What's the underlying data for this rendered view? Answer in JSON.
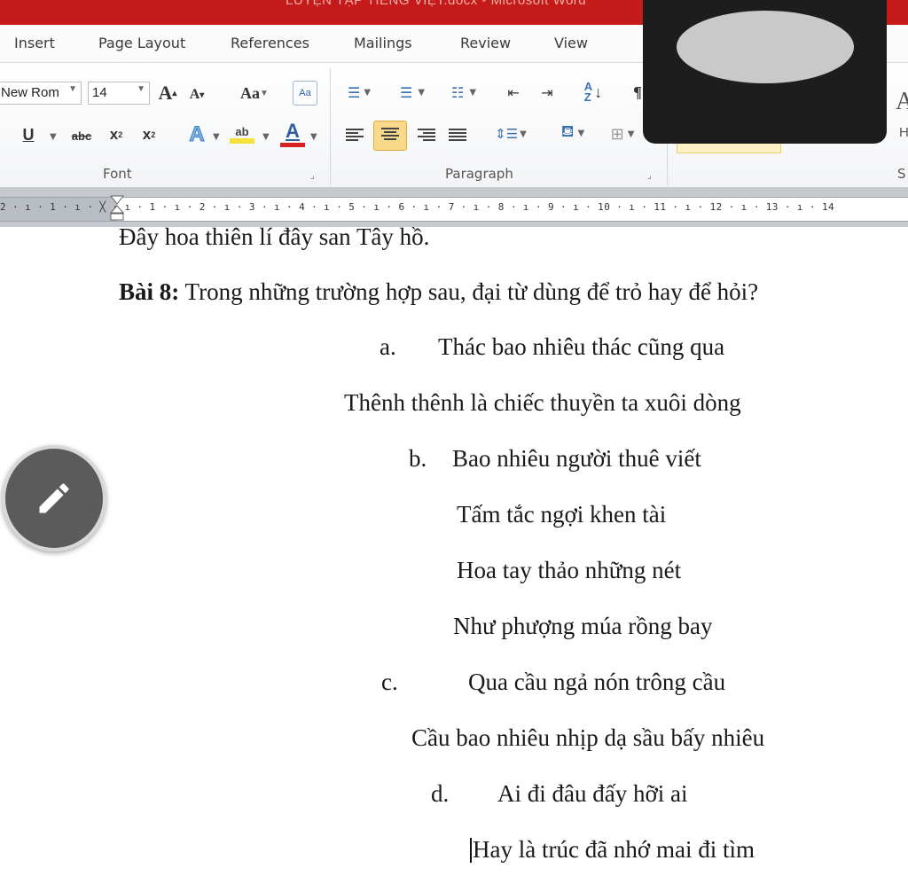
{
  "window": {
    "title": "LUYỆN TẬP TIẾNG VIỆT.docx - Microsoft Word"
  },
  "tabs": [
    "Insert",
    "Page Layout",
    "References",
    "Mailings",
    "Review",
    "View"
  ],
  "ribbon": {
    "font": {
      "name": "New Rom",
      "size": "14",
      "grow_icon": "A",
      "shrink_icon": "A",
      "case_label": "Aa",
      "underline": "U",
      "strike": "abc",
      "subscript": "x",
      "superscript": "x",
      "highlight": "ab",
      "color": "A",
      "group_label": "Font",
      "font_color_hex": "#d62020",
      "highlight_hex": "#f5e13a"
    },
    "paragraph": {
      "group_label": "Paragraph",
      "active_alignment": "center"
    },
    "styles": {
      "big_glyph": "A",
      "small_glyph": "H",
      "partial_label": "S"
    }
  },
  "ruler": {
    "labels": "2 · ı · 1 · ı · ╳ · ı · 1 · ı · 2 · ı · 3 · ı · 4 · ı · 5 · ı · 6 · ı · 7 · ı · 8 · ı · 9 · ı · 10 · ı · 11 · ı · 12 · ı · 13 · ı · 14"
  },
  "document": {
    "line_top": "Đây hoa thiên lí đây san Tây hồ.",
    "heading_bold": "Bài 8:",
    "heading_rest": " Trong những trường hợp sau, đại từ dùng để trỏ hay để hỏi?",
    "a_marker": "a.",
    "a_line1": "Thác bao nhiêu thác cũng qua",
    "a_line2": "Thênh thênh là chiếc thuyền ta xuôi dòng",
    "b_marker": "b.",
    "b_line1": "Bao nhiêu người thuê viết",
    "b_line2": "Tấm tắc ngợi khen tài",
    "b_line3": "Hoa tay thảo những nét",
    "b_line4": "Như phượng múa rồng bay",
    "c_marker": "c.",
    "c_line1": "Qua cầu ngả nón trông cầu",
    "c_line2": "Cầu bao nhiêu nhịp dạ sầu bấy nhiêu",
    "d_marker": "d.",
    "d_line1": "Ai đi đâu đấy hỡi ai",
    "d_line2": "Hay là trúc đã nhớ mai đi tìm"
  },
  "icons": {
    "fab": "pencil-icon"
  }
}
